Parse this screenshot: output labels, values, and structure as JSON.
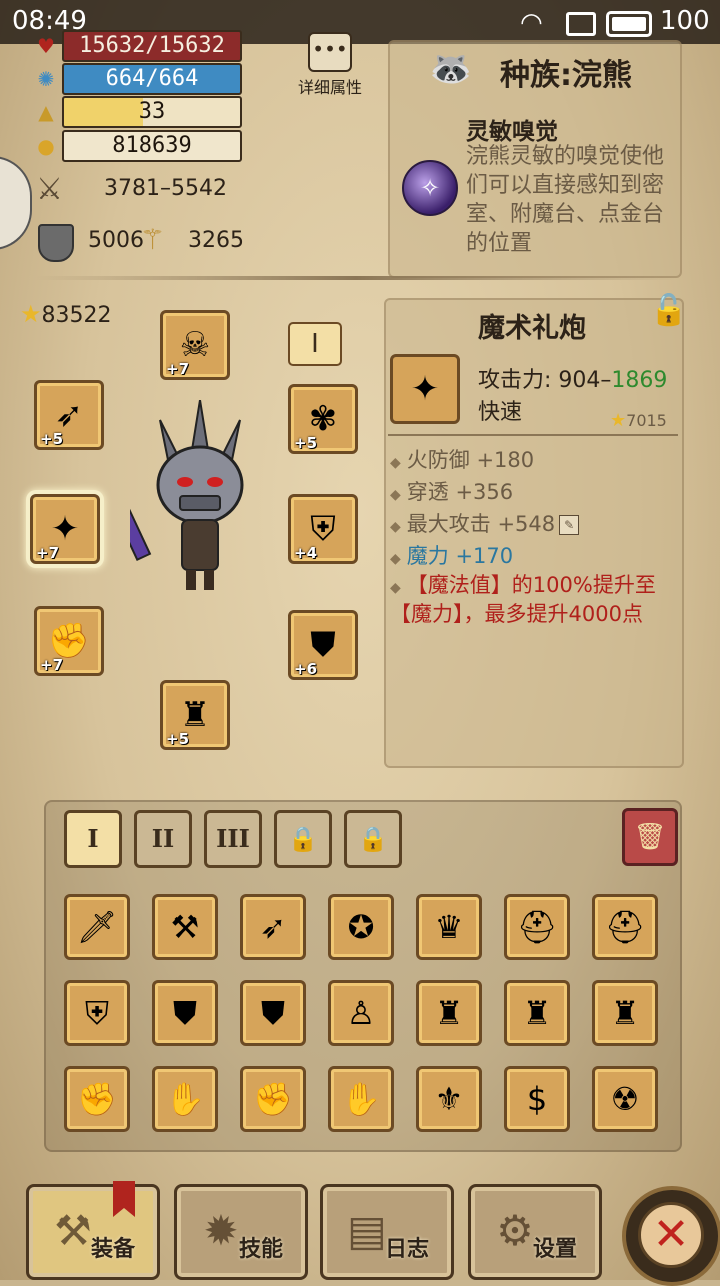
{
  "status_bar": {
    "time": "08:49",
    "battery": "100"
  },
  "stats": {
    "hp": "15632/15632",
    "mp": "664/664",
    "level": "33",
    "gold": "818639",
    "attack": "3781–5542",
    "armor": "5006",
    "magic": "3265"
  },
  "detail_button": {
    "label": "详细属性"
  },
  "race": {
    "title": "种族:浣熊",
    "skill_name": "灵敏嗅觉",
    "skill_desc": "浣熊灵敏的嗅觉使他们可以直接感知到密室、附魔台、点金台的位置"
  },
  "equipment": {
    "power": "83522",
    "loadout_tab": "I",
    "slots": [
      {
        "name": "helmet",
        "icon": "skull-helmet-icon",
        "glyph": "☠",
        "level": "+7"
      },
      {
        "name": "amulet",
        "icon": "amulet-icon",
        "glyph": "✾",
        "level": "+5"
      },
      {
        "name": "shoulders",
        "icon": "shoulders-icon",
        "glyph": "⛨",
        "level": "+4"
      },
      {
        "name": "chest",
        "icon": "chest-armor-icon",
        "glyph": "⛊",
        "level": "+6"
      },
      {
        "name": "boots",
        "icon": "boots-icon",
        "glyph": "♜",
        "level": "+5"
      },
      {
        "name": "gloves",
        "icon": "gauntlet-icon",
        "glyph": "✊",
        "level": "+7"
      },
      {
        "name": "weapon",
        "icon": "firework-cannon-icon",
        "glyph": "✦",
        "level": "+7"
      },
      {
        "name": "offhand",
        "icon": "bow-icon",
        "glyph": "➶",
        "level": "+5"
      }
    ]
  },
  "item": {
    "name": "魔术礼炮",
    "atk_label": "攻击力: 904",
    "atk_sep": "–",
    "atk_high": "1869",
    "speed": "快速",
    "score": "7015",
    "affixes": [
      "火防御 +180",
      "穿透 +356",
      "最大攻击 +548"
    ],
    "magic_affix": "魔力 +170",
    "special": "【魔法值】的100%提升至【魔力】，最多提升4000点"
  },
  "bag": {
    "tabs": [
      "I",
      "II",
      "III"
    ],
    "items": [
      {
        "icon": "sword-icon",
        "glyph": "🗡"
      },
      {
        "icon": "hammer-icon",
        "glyph": "⚒"
      },
      {
        "icon": "bow-icon",
        "glyph": "➶"
      },
      {
        "icon": "green-amulet-icon",
        "glyph": "✪"
      },
      {
        "icon": "crown-icon",
        "glyph": "♛"
      },
      {
        "icon": "samurai-helmet-icon",
        "glyph": "⛑"
      },
      {
        "icon": "samurai-helmet-icon",
        "glyph": "⛑"
      },
      {
        "icon": "spiked-pauldrons-icon",
        "glyph": "⛨"
      },
      {
        "icon": "blue-armor-icon",
        "glyph": "⛊"
      },
      {
        "icon": "red-armor-icon",
        "glyph": "⛊"
      },
      {
        "icon": "robe-icon",
        "glyph": "♙"
      },
      {
        "icon": "red-boots-icon",
        "glyph": "♜"
      },
      {
        "icon": "teal-boots-icon",
        "glyph": "♜"
      },
      {
        "icon": "teal-boots-icon",
        "glyph": "♜"
      },
      {
        "icon": "gauntlet-icon",
        "glyph": "✊"
      },
      {
        "icon": "red-glove-icon",
        "glyph": "✋"
      },
      {
        "icon": "leather-bracer-icon",
        "glyph": "✊"
      },
      {
        "icon": "purple-glove-icon",
        "glyph": "✋"
      },
      {
        "icon": "shield-crest-icon",
        "glyph": "⚜"
      },
      {
        "icon": "gold-dollar-ring-icon",
        "glyph": "$"
      },
      {
        "icon": "pouch-ring-icon",
        "glyph": "☢"
      }
    ]
  },
  "nav": {
    "equip": "装备",
    "skills": "技能",
    "log": "日志",
    "settings": "设置"
  }
}
